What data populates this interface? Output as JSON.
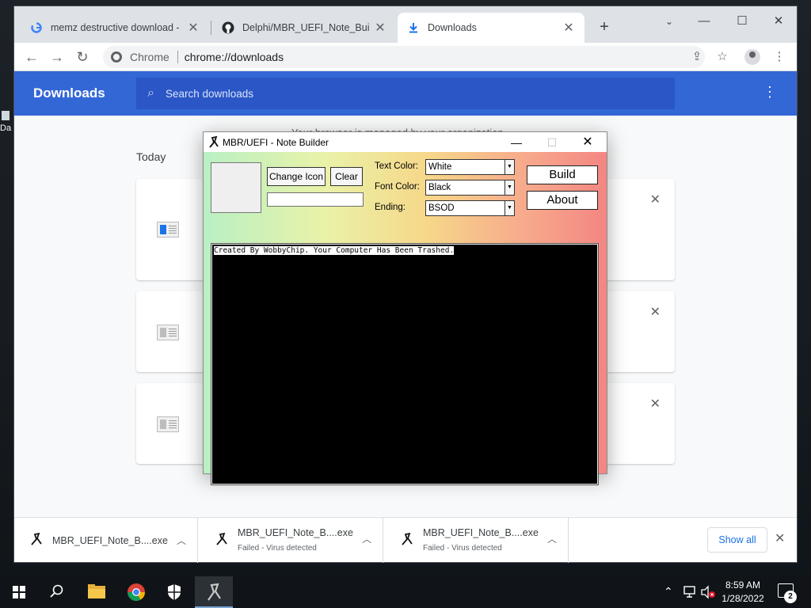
{
  "desktop": {
    "icon_label": "Da"
  },
  "browser": {
    "tabs": [
      {
        "title": "memz destructive download - G",
        "favicon": "google-icon"
      },
      {
        "title": "Delphi/MBR_UEFI_Note_Builder",
        "favicon": "github-icon"
      },
      {
        "title": "Downloads",
        "favicon": "download-icon"
      }
    ],
    "omnibox": {
      "chip": "Chrome",
      "url": "chrome://downloads"
    }
  },
  "downloads_page": {
    "header_title": "Downloads",
    "search_placeholder": "Search downloads",
    "managed_notice": "Your browser is managed by your organization",
    "date_heading": "Today",
    "cards": [
      {
        "icon": "file-icon-blue"
      },
      {
        "icon": "file-icon"
      },
      {
        "icon": "file-icon"
      }
    ]
  },
  "shelf": {
    "items": [
      {
        "name": "MBR_UEFI_Note_B....exe",
        "status": ""
      },
      {
        "name": "MBR_UEFI_Note_B....exe",
        "status": "Failed - Virus detected"
      },
      {
        "name": "MBR_UEFI_Note_B....exe",
        "status": "Failed - Virus detected"
      }
    ],
    "show_all": "Show all"
  },
  "app": {
    "title": "MBR/UEFI - Note Builder",
    "change_icon": "Change Icon",
    "clear": "Clear",
    "text_color_label": "Text Color:",
    "text_color_value": "White",
    "font_color_label": "Font Color:",
    "font_color_value": "Black",
    "ending_label": "Ending:",
    "ending_value": "BSOD",
    "build": "Build",
    "about": "About",
    "note_text": "Created By WobbyChip. Your Computer Has Been Trashed."
  },
  "taskbar": {
    "time": "8:59 AM",
    "date": "1/28/2022",
    "notification_count": "2"
  }
}
